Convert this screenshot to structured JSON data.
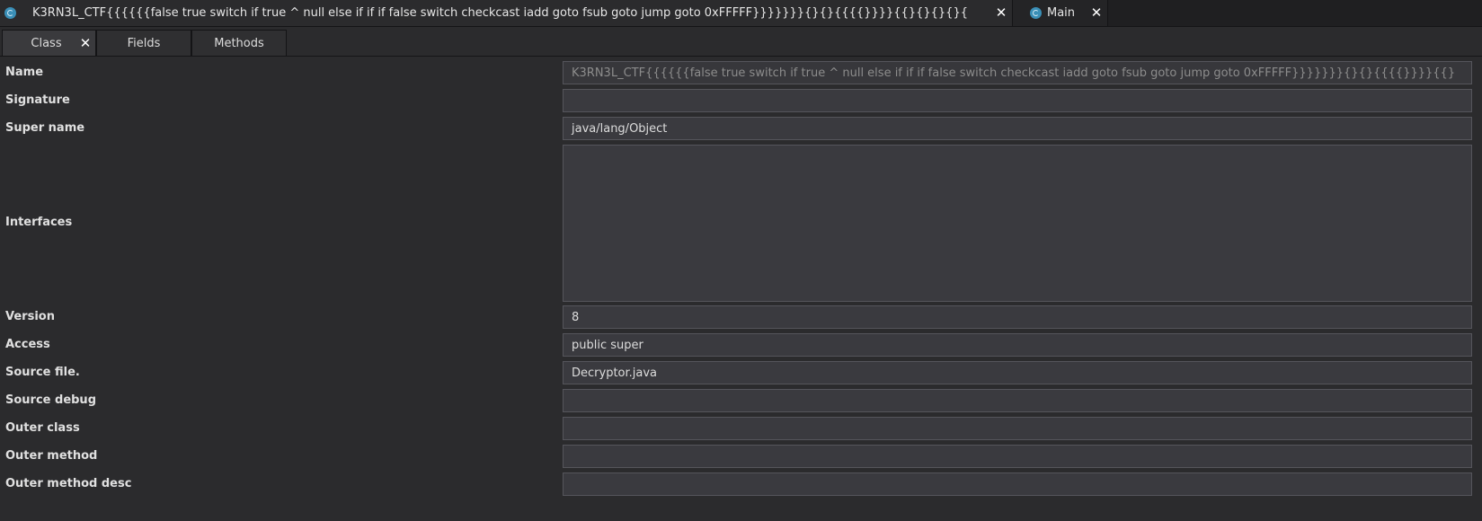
{
  "top_tabs": [
    {
      "title": "K3RN3L_CTF{{{{{{false true switch if true ^ null    else if   if if false switch checkcast iadd goto fsub goto jump goto 0xFFFFF}}}}}}}{}{}{{{{}}}}{{}{}{}{}{",
      "icon": "class-icon",
      "close": "✕"
    },
    {
      "title": "Main",
      "icon": "class-icon",
      "close": "✕"
    }
  ],
  "sub_tabs": [
    {
      "label": "Class",
      "close": "✕"
    },
    {
      "label": "Fields"
    },
    {
      "label": "Methods"
    }
  ],
  "fields": [
    {
      "label": "Name",
      "value": "K3RN3L_CTF{{{{{{false true switch if true ^ null else if   if if false switch checkcast iadd goto fsub goto jump goto 0xFFFFF}}}}}}}{}{}{{{{}}}}{{}"
    },
    {
      "label": "Signature",
      "value": ""
    },
    {
      "label": "Super name",
      "value": "java/lang/Object"
    },
    {
      "label": "Interfaces",
      "value": ""
    },
    {
      "label": "Version",
      "value": "8"
    },
    {
      "label": "Access",
      "value": "public super"
    },
    {
      "label": "Source file.",
      "value": "Decryptor.java"
    },
    {
      "label": "Source debug",
      "value": ""
    },
    {
      "label": "Outer class",
      "value": ""
    },
    {
      "label": "Outer method",
      "value": ""
    },
    {
      "label": "Outer method desc",
      "value": ""
    }
  ]
}
